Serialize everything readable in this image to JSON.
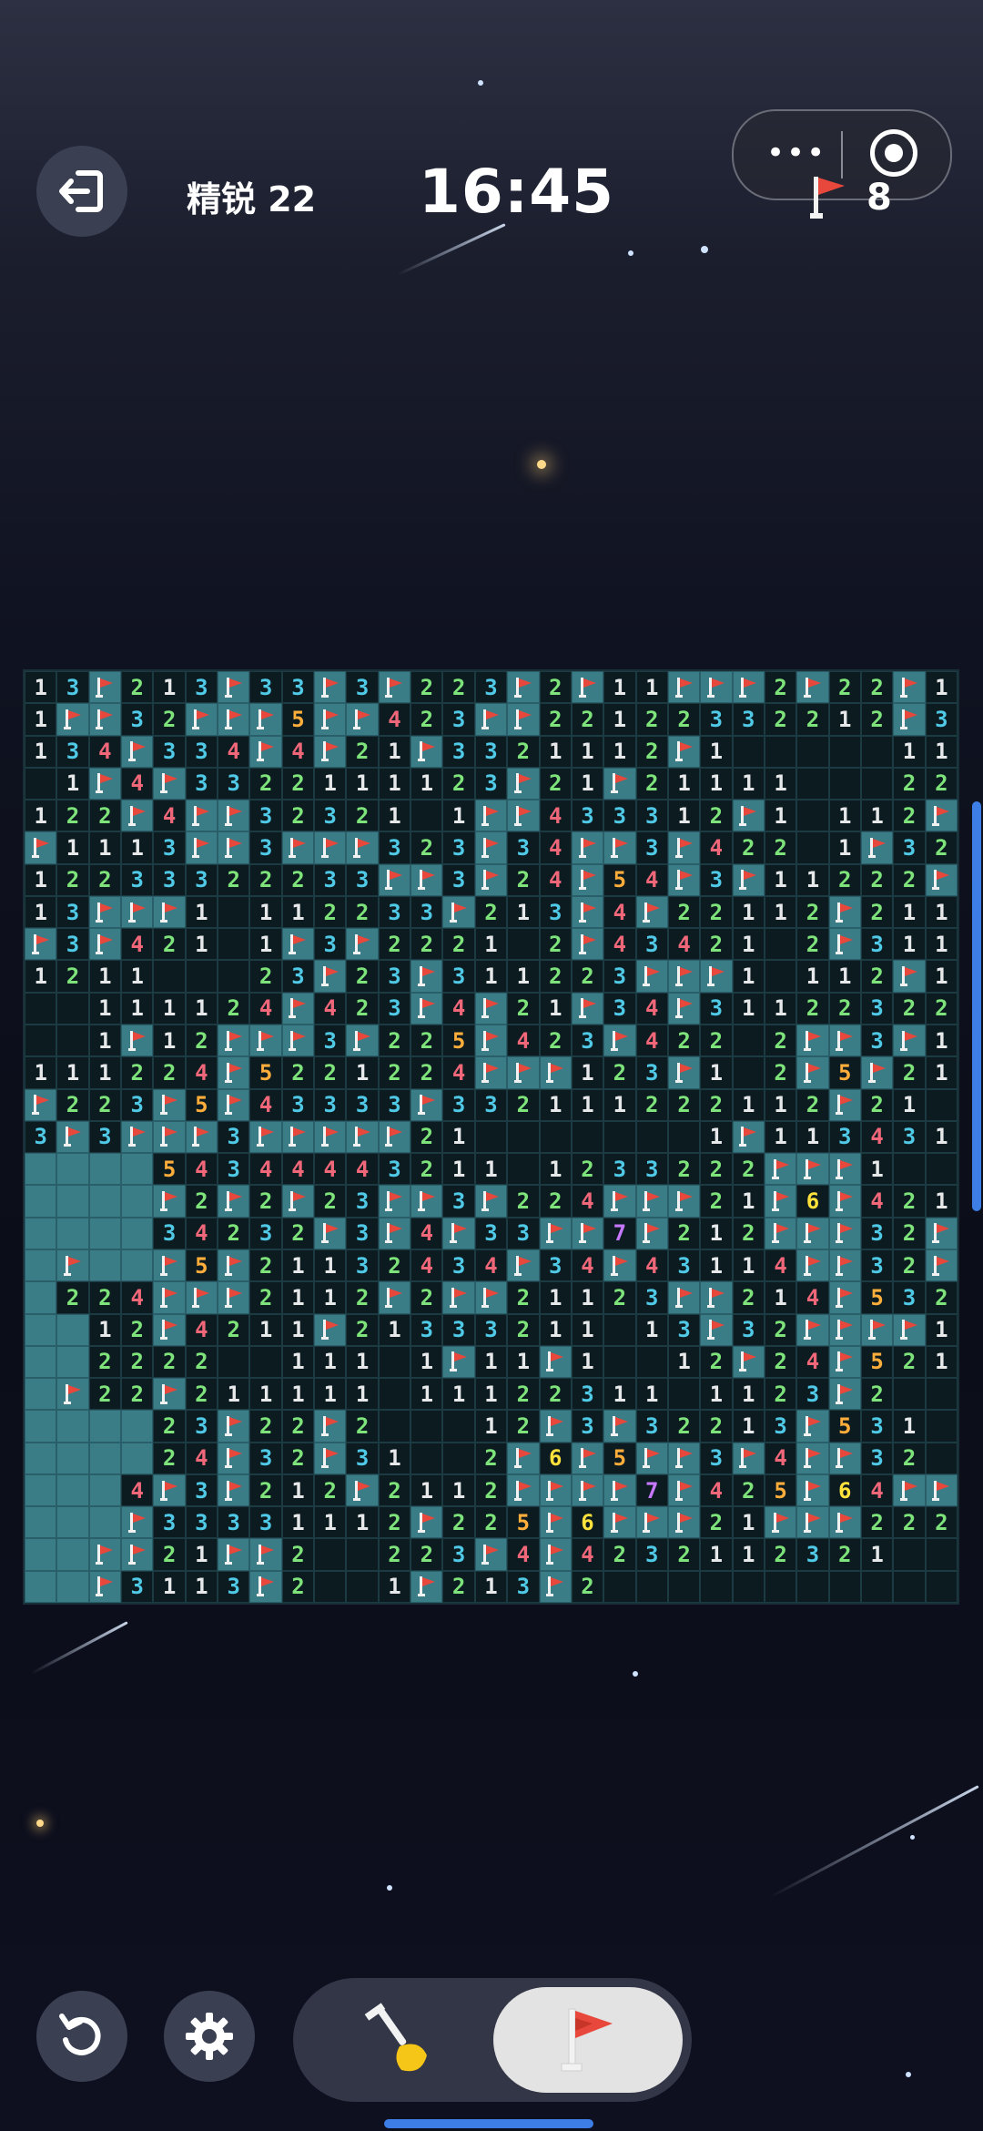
{
  "header": {
    "level_label": "精锐 22",
    "timer": "16:45",
    "flags_remaining": "8",
    "capsule_more": "•••"
  },
  "board": {
    "columns": 29,
    "rows": [
      "1,3,F,2,1,3,F,3,3,F,3,F,2,2,3,F,2,F,1,1,F,F,F,2,F,2,2,F,1",
      "1,F,F,3,2,F,F,F,5,F,F,4,2,3,F,F,2,2,1,2,2,3,3,2,2,1,2,F,3,2",
      "1,3,4,F,3,3,4,F,4,F,2,1,F,3,3,2,1,1,1,2,F,1,,,,,,1,1,2,F",
      ",1,F,4,F,3,3,2,2,1,1,1,1,2,3,F,2,1,F,2,1,1,1,1,,,,2,2",
      "1,2,2,F,4,F,F,3,2,3,2,1,,1,F,F,4,3,3,3,1,2,F,1,,1,1,2,F",
      "F,1,1,1,3,F,F,3,F,F,F,3,2,3,F,3,4,F,F,3,F,4,2,2,,1,F,3,2",
      "1,2,2,3,3,3,2,2,2,3,3,F,F,3,F,2,4,F,5,4,F,3,F,1,1,2,2,2,F",
      "1,3,F,F,F,1,,1,1,2,2,3,3,F,2,1,3,F,4,F,2,2,1,1,2,F,2,1,1",
      "F,3,F,4,2,1,,1,F,3,F,2,2,2,1,,2,F,4,3,4,2,1,,2,F,3,1,1",
      "1,2,1,1,,,,2,3,F,2,3,F,3,1,1,2,2,3,F,F,F,1,,1,1,2,F,1",
      ",,1,1,1,1,2,4,F,4,2,3,F,4,F,2,1,F,3,4,F,3,1,1,2,2,3,2,2",
      ",,1,F,1,2,F,F,F,3,F,2,2,5,F,4,2,3,F,4,2,2,,2,F,F,3,F,1",
      "1,1,1,2,2,4,F,5,2,2,1,2,2,4,F,F,F,1,2,3,F,1,,2,F,5,F,2,1",
      "F,2,2,3,F,5,F,4,3,3,3,3,F,3,3,2,1,1,1,2,2,2,1,1,2,F,2,1,",
      "3,F,3,F,F,F,3,F,F,F,F,F,2,1,,,,,,,,1,F,1,1,3,4,3,1",
      "H,H,H,H,5,4,3,4,4,4,4,3,2,1,1,,1,2,3,3,2,2,2,F,F,F,1,,",
      "H,H,H,H,F,2,F,2,F,2,3,F,F,3,F,2,2,4,F,F,F,2,1,F,6,F,4,2,1",
      "H,H,H,H,3,4,2,3,2,F,3,F,4,F,3,3,F,F,7,F,2,1,2,F,F,F,3,2,F",
      "H,F,H,H,F,5,F,2,1,1,3,2,4,3,4,F,3,4,F,4,3,1,1,4,F,F,3,2,F",
      "H,2,2,4,F,F,F,2,1,1,2,F,2,F,F,2,1,1,2,3,F,F,2,1,4,F,5,3,2",
      "H,H,1,2,F,4,2,1,1,F,2,1,3,3,3,2,1,1,,1,3,F,3,2,F,F,F,F,1",
      "H,H,2,2,2,2,,,1,1,1,,1,F,1,1,F,1,,,1,2,F,2,4,F,5,2,1",
      "H,F,2,2,F,2,1,1,1,1,1,,1,1,1,2,2,3,1,1,,1,1,2,3,F,2,,",
      "H,H,H,H,2,3,F,2,2,F,2,,,,1,2,F,3,F,3,2,2,1,3,F,5,3,1,",
      "H,H,H,H,2,4,F,3,2,F,3,1,,,2,F,6,F,5,F,F,3,F,4,F,F,3,2,",
      "H,H,H,4,F,3,F,2,1,2,F,2,1,1,2,F,F,F,F,7,F,4,2,5,F,6,4,F,F",
      "H,H,H,F,3,3,3,3,1,1,1,2,F,2,2,5,F,6,F,F,F,2,1,F,F,F,2,2,2",
      "H,H,F,F,2,1,F,F,2,,,2,2,3,F,4,F,4,2,3,2,1,1,2,3,2,1,,",
      "H,H,F,3,1,1,3,F,2,,,1,F,2,1,3,F,2,,,,,,,,,,,"
    ]
  },
  "controls": {
    "dig_mode": "dig",
    "flag_mode": "flag",
    "active_mode": "flag"
  },
  "colors": {
    "n1": "#e6e8ea",
    "n2": "#7de37a",
    "n3": "#4fc9e6",
    "n4": "#f0677a",
    "n5": "#ffae3b",
    "n6": "#ffe23b",
    "n7": "#c678ff",
    "hidden_tile": "#3b7d87",
    "flag_red": "#e8473b",
    "accent": "#3d7de6"
  }
}
